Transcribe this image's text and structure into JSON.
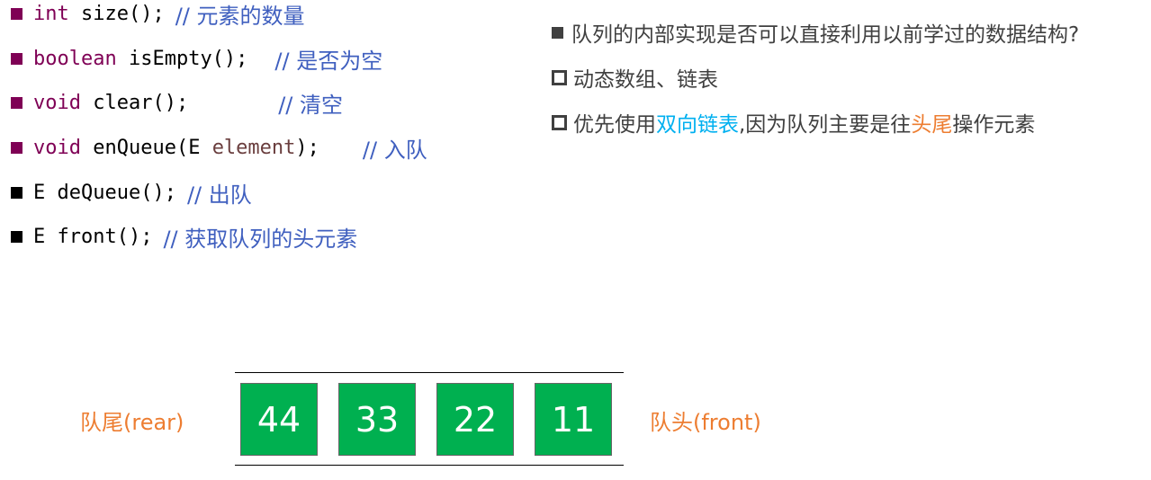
{
  "api": [
    {
      "bullet_color": "#7f0055",
      "kw": "int",
      "code": "size();",
      "gap": "  ",
      "comment": "// 元素的数量"
    },
    {
      "bullet_color": "#7f0055",
      "kw": "boolean",
      "code": "isEmpty();",
      "gap": "  ",
      "comment": "// 是否为空"
    },
    {
      "bullet_color": "#7f0055",
      "kw": "void",
      "code": "clear();",
      "gap": "       ",
      "comment": "// 清空"
    },
    {
      "bullet_color": "#7f0055",
      "kw": "void",
      "code_pre": "enQueue(E ",
      "param": "element",
      "code_post": ");",
      "gap": "    ",
      "comment": "// 入队"
    },
    {
      "bullet_color": "#000000",
      "kw_plain": "E",
      "code": "deQueue();",
      "gap": " ",
      "comment": "// 出队"
    },
    {
      "bullet_color": "#000000",
      "kw_plain": "E",
      "code": "front();",
      "gap": " ",
      "comment": "// 获取队列的头元素"
    }
  ],
  "notes": {
    "q1": "队列的内部实现是否可以直接利用以前学过的数据结构?",
    "a1": "动态数组、链表",
    "a2_pre": "优先使用",
    "a2_blue": "双向链表",
    "a2_mid": ",因为队列主要是往",
    "a2_orange": "头尾",
    "a2_post": "操作元素"
  },
  "queue": {
    "rear_label": "队尾(rear)",
    "front_label": "队头(front)",
    "values": [
      "44",
      "33",
      "22",
      "11"
    ]
  },
  "colors": {
    "keyword": "#7f0055",
    "comment": "#3f5fbf",
    "cell": "#00b050",
    "accent_orange": "#ed7d31",
    "accent_blue": "#00b0f0"
  }
}
